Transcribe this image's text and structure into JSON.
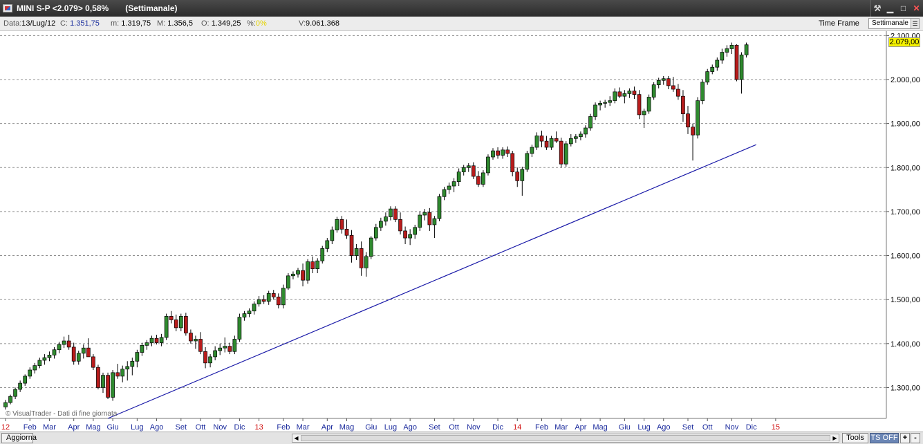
{
  "window": {
    "symbol": "MINI S-P <2.079> 0,58%",
    "period": "(Settimanale)",
    "buttons": [
      "pin-icon",
      "minimize-icon",
      "maximize-icon",
      "close-icon"
    ]
  },
  "infobar": {
    "data_label": "Data:",
    "data_value": "13/Lug/12",
    "c_label": "C:",
    "c_value": "1.351,75",
    "m_label": "m:",
    "m_value": "1.319,75",
    "mx_label": "M:",
    "mx_value": "1.356,5",
    "o_label": "O:",
    "o_value": "1.349,25",
    "pct_label": "%:",
    "pct_value": "0%",
    "v_label": "V:",
    "v_value": "9.061.368",
    "timeframe_label": "Time Frame",
    "timeframe_value": "Settimanale"
  },
  "chart_data": {
    "type": "candlestick",
    "title": "MINI S-P",
    "period": "weekly",
    "last_price_label": "2.079,00",
    "ylim": [
      1230,
      2110
    ],
    "y_ticks": [
      1300,
      1400,
      1500,
      1600,
      1700,
      1800,
      1900,
      2000,
      2100
    ],
    "y_tick_labels": [
      "1.300,00",
      "1.400,00",
      "1.500,00",
      "1.600,00",
      "1.700,00",
      "1.800,00",
      "1.900,00",
      "2.000,00",
      "2.100,00"
    ],
    "x_tick_labels": [
      {
        "label": "12",
        "week": 0,
        "year": true
      },
      {
        "label": "Feb",
        "week": 5
      },
      {
        "label": "Mar",
        "week": 9
      },
      {
        "label": "Apr",
        "week": 14
      },
      {
        "label": "Mag",
        "week": 18
      },
      {
        "label": "Giu",
        "week": 22
      },
      {
        "label": "Lug",
        "week": 27
      },
      {
        "label": "Ago",
        "week": 31
      },
      {
        "label": "Set",
        "week": 36
      },
      {
        "label": "Ott",
        "week": 40
      },
      {
        "label": "Nov",
        "week": 44
      },
      {
        "label": "Dic",
        "week": 48
      },
      {
        "label": "13",
        "week": 52,
        "year": true
      },
      {
        "label": "Feb",
        "week": 57
      },
      {
        "label": "Mar",
        "week": 61
      },
      {
        "label": "Apr",
        "week": 66
      },
      {
        "label": "Mag",
        "week": 70
      },
      {
        "label": "Giu",
        "week": 75
      },
      {
        "label": "Lug",
        "week": 79
      },
      {
        "label": "Ago",
        "week": 83
      },
      {
        "label": "Set",
        "week": 88
      },
      {
        "label": "Ott",
        "week": 92
      },
      {
        "label": "Nov",
        "week": 96
      },
      {
        "label": "Dic",
        "week": 101
      },
      {
        "label": "14",
        "week": 105,
        "year": true
      },
      {
        "label": "Feb",
        "week": 110
      },
      {
        "label": "Mar",
        "week": 114
      },
      {
        "label": "Apr",
        "week": 118
      },
      {
        "label": "Mag",
        "week": 122
      },
      {
        "label": "Giu",
        "week": 127
      },
      {
        "label": "Lug",
        "week": 131
      },
      {
        "label": "Ago",
        "week": 135
      },
      {
        "label": "Set",
        "week": 140
      },
      {
        "label": "Ott",
        "week": 144
      },
      {
        "label": "Nov",
        "week": 149
      },
      {
        "label": "Dic",
        "week": 153
      },
      {
        "label": "15",
        "week": 158,
        "year": true
      }
    ],
    "trendline": {
      "from": {
        "week": 21,
        "value": 1230
      },
      "to": {
        "week": 154,
        "value": 1852
      }
    },
    "grid": true,
    "candles": [
      [
        1256,
        1272,
        1250,
        1266
      ],
      [
        1266,
        1284,
        1262,
        1280
      ],
      [
        1280,
        1300,
        1274,
        1296
      ],
      [
        1296,
        1316,
        1290,
        1310
      ],
      [
        1310,
        1330,
        1304,
        1326
      ],
      [
        1326,
        1346,
        1320,
        1340
      ],
      [
        1340,
        1356,
        1332,
        1350
      ],
      [
        1350,
        1368,
        1344,
        1362
      ],
      [
        1362,
        1376,
        1352,
        1368
      ],
      [
        1368,
        1382,
        1360,
        1374
      ],
      [
        1374,
        1392,
        1366,
        1386
      ],
      [
        1386,
        1404,
        1378,
        1398
      ],
      [
        1398,
        1416,
        1390,
        1406
      ],
      [
        1406,
        1420,
        1386,
        1392
      ],
      [
        1392,
        1402,
        1352,
        1360
      ],
      [
        1360,
        1384,
        1352,
        1378
      ],
      [
        1378,
        1398,
        1366,
        1390
      ],
      [
        1390,
        1412,
        1376,
        1370
      ],
      [
        1370,
        1376,
        1340,
        1346
      ],
      [
        1346,
        1352,
        1296,
        1300
      ],
      [
        1300,
        1334,
        1288,
        1328
      ],
      [
        1328,
        1334,
        1274,
        1278
      ],
      [
        1278,
        1340,
        1270,
        1334
      ],
      [
        1334,
        1354,
        1320,
        1326
      ],
      [
        1326,
        1350,
        1312,
        1342
      ],
      [
        1342,
        1360,
        1316,
        1348
      ],
      [
        1348,
        1368,
        1328,
        1360
      ],
      [
        1360,
        1386,
        1346,
        1380
      ],
      [
        1380,
        1402,
        1372,
        1396
      ],
      [
        1396,
        1408,
        1386,
        1402
      ],
      [
        1402,
        1418,
        1394,
        1412
      ],
      [
        1412,
        1420,
        1398,
        1402
      ],
      [
        1402,
        1422,
        1394,
        1414
      ],
      [
        1414,
        1468,
        1408,
        1462
      ],
      [
        1462,
        1474,
        1446,
        1454
      ],
      [
        1454,
        1466,
        1428,
        1436
      ],
      [
        1436,
        1468,
        1428,
        1462
      ],
      [
        1462,
        1470,
        1418,
        1424
      ],
      [
        1424,
        1432,
        1400,
        1406
      ],
      [
        1406,
        1418,
        1388,
        1410
      ],
      [
        1410,
        1426,
        1376,
        1382
      ],
      [
        1382,
        1392,
        1344,
        1356
      ],
      [
        1356,
        1376,
        1346,
        1370
      ],
      [
        1370,
        1394,
        1362,
        1384
      ],
      [
        1384,
        1400,
        1374,
        1390
      ],
      [
        1390,
        1414,
        1380,
        1394
      ],
      [
        1394,
        1402,
        1376,
        1382
      ],
      [
        1382,
        1418,
        1376,
        1410
      ],
      [
        1410,
        1468,
        1404,
        1460
      ],
      [
        1460,
        1474,
        1452,
        1468
      ],
      [
        1468,
        1480,
        1460,
        1474
      ],
      [
        1474,
        1496,
        1466,
        1490
      ],
      [
        1490,
        1508,
        1484,
        1500
      ],
      [
        1500,
        1510,
        1490,
        1496
      ],
      [
        1496,
        1520,
        1488,
        1514
      ],
      [
        1514,
        1522,
        1500,
        1506
      ],
      [
        1506,
        1514,
        1480,
        1488
      ],
      [
        1488,
        1534,
        1480,
        1526
      ],
      [
        1526,
        1560,
        1522,
        1554
      ],
      [
        1554,
        1564,
        1546,
        1558
      ],
      [
        1558,
        1572,
        1550,
        1566
      ],
      [
        1566,
        1582,
        1530,
        1544
      ],
      [
        1544,
        1592,
        1536,
        1586
      ],
      [
        1586,
        1598,
        1560,
        1570
      ],
      [
        1570,
        1594,
        1560,
        1588
      ],
      [
        1588,
        1622,
        1582,
        1616
      ],
      [
        1616,
        1640,
        1608,
        1634
      ],
      [
        1634,
        1666,
        1626,
        1658
      ],
      [
        1658,
        1688,
        1652,
        1682
      ],
      [
        1682,
        1690,
        1650,
        1660
      ],
      [
        1660,
        1682,
        1638,
        1646
      ],
      [
        1646,
        1658,
        1584,
        1600
      ],
      [
        1600,
        1626,
        1590,
        1616
      ],
      [
        1616,
        1632,
        1554,
        1572
      ],
      [
        1572,
        1608,
        1552,
        1598
      ],
      [
        1598,
        1644,
        1592,
        1640
      ],
      [
        1640,
        1672,
        1634,
        1664
      ],
      [
        1664,
        1686,
        1656,
        1678
      ],
      [
        1678,
        1698,
        1668,
        1688
      ],
      [
        1688,
        1712,
        1680,
        1706
      ],
      [
        1706,
        1712,
        1676,
        1682
      ],
      [
        1682,
        1698,
        1648,
        1656
      ],
      [
        1656,
        1666,
        1626,
        1640
      ],
      [
        1640,
        1660,
        1624,
        1648
      ],
      [
        1648,
        1670,
        1638,
        1664
      ],
      [
        1664,
        1700,
        1656,
        1692
      ],
      [
        1692,
        1706,
        1680,
        1698
      ],
      [
        1698,
        1708,
        1656,
        1670
      ],
      [
        1670,
        1690,
        1640,
        1684
      ],
      [
        1684,
        1740,
        1678,
        1734
      ],
      [
        1734,
        1756,
        1726,
        1750
      ],
      [
        1750,
        1766,
        1740,
        1758
      ],
      [
        1758,
        1776,
        1744,
        1768
      ],
      [
        1768,
        1798,
        1758,
        1790
      ],
      [
        1790,
        1806,
        1782,
        1800
      ],
      [
        1800,
        1810,
        1790,
        1804
      ],
      [
        1804,
        1812,
        1774,
        1780
      ],
      [
        1780,
        1792,
        1756,
        1762
      ],
      [
        1762,
        1794,
        1756,
        1788
      ],
      [
        1788,
        1830,
        1782,
        1824
      ],
      [
        1824,
        1844,
        1818,
        1838
      ],
      [
        1838,
        1846,
        1820,
        1828
      ],
      [
        1828,
        1846,
        1820,
        1840
      ],
      [
        1840,
        1848,
        1824,
        1832
      ],
      [
        1832,
        1838,
        1780,
        1790
      ],
      [
        1790,
        1800,
        1756,
        1770
      ],
      [
        1770,
        1802,
        1736,
        1796
      ],
      [
        1796,
        1838,
        1790,
        1832
      ],
      [
        1832,
        1852,
        1824,
        1846
      ],
      [
        1846,
        1880,
        1840,
        1872
      ],
      [
        1872,
        1884,
        1846,
        1860
      ],
      [
        1860,
        1872,
        1840,
        1846
      ],
      [
        1846,
        1872,
        1840,
        1866
      ],
      [
        1866,
        1882,
        1856,
        1860
      ],
      [
        1860,
        1868,
        1800,
        1808
      ],
      [
        1808,
        1860,
        1802,
        1854
      ],
      [
        1854,
        1876,
        1848,
        1866
      ],
      [
        1866,
        1876,
        1856,
        1870
      ],
      [
        1870,
        1882,
        1862,
        1876
      ],
      [
        1876,
        1896,
        1868,
        1890
      ],
      [
        1890,
        1922,
        1884,
        1916
      ],
      [
        1916,
        1948,
        1908,
        1942
      ],
      [
        1942,
        1952,
        1930,
        1946
      ],
      [
        1946,
        1954,
        1936,
        1948
      ],
      [
        1948,
        1962,
        1940,
        1952
      ],
      [
        1952,
        1980,
        1946,
        1972
      ],
      [
        1972,
        1982,
        1958,
        1962
      ],
      [
        1962,
        1976,
        1946,
        1968
      ],
      [
        1968,
        1980,
        1958,
        1974
      ],
      [
        1974,
        1984,
        1956,
        1966
      ],
      [
        1966,
        1976,
        1910,
        1920
      ],
      [
        1920,
        1934,
        1890,
        1928
      ],
      [
        1928,
        1966,
        1922,
        1960
      ],
      [
        1960,
        1994,
        1954,
        1988
      ],
      [
        1988,
        2004,
        1980,
        1998
      ],
      [
        1998,
        2008,
        1988,
        2002
      ],
      [
        2002,
        2008,
        1978,
        1986
      ],
      [
        1986,
        2006,
        1972,
        1978
      ],
      [
        1978,
        1990,
        1954,
        1962
      ],
      [
        1962,
        1976,
        1904,
        1922
      ],
      [
        1922,
        1940,
        1876,
        1892
      ],
      [
        1892,
        1900,
        1816,
        1874
      ],
      [
        1874,
        1960,
        1866,
        1952
      ],
      [
        1952,
        2000,
        1944,
        1994
      ],
      [
        1994,
        2024,
        1988,
        2018
      ],
      [
        2018,
        2034,
        2012,
        2028
      ],
      [
        2028,
        2050,
        2020,
        2044
      ],
      [
        2044,
        2070,
        2036,
        2062
      ],
      [
        2062,
        2078,
        2052,
        2070
      ],
      [
        2070,
        2084,
        2058,
        2078
      ],
      [
        2078,
        2080,
        1996,
        2000
      ],
      [
        2000,
        2062,
        1968,
        2056
      ],
      [
        2056,
        2084,
        2050,
        2079
      ]
    ]
  },
  "footer": {
    "watermark": "© VisualTrader - Dati di fine giornata",
    "refresh_label": "Aggiorna",
    "tools_label": "Tools",
    "ts_label": "TS OFF",
    "plus_label": "+",
    "minus_label": "-"
  }
}
